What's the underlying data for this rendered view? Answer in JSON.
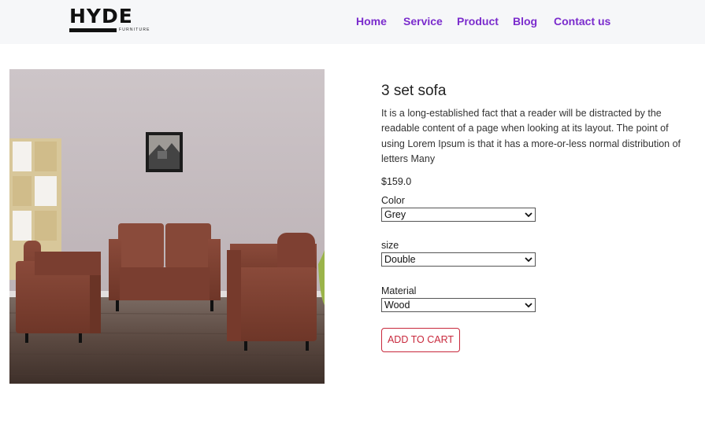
{
  "brand": {
    "name": "HYDE",
    "tagline": "FURNITURE"
  },
  "nav": {
    "items": [
      "Home",
      "Service",
      "Product",
      "Blog",
      "Contact us"
    ]
  },
  "product": {
    "title": "3 set sofa",
    "description": "It is a long-established fact that a reader will be distracted by the readable content of a page when looking at its layout. The point of using Lorem Ipsum is that it has a more-or-less normal distribution of letters Many",
    "price": "$159.0",
    "color": {
      "label": "Color",
      "value": "Grey"
    },
    "size": {
      "label": "size",
      "value": "Double"
    },
    "material": {
      "label": "Material",
      "value": "Wood"
    },
    "cart_button": "ADD TO CART"
  },
  "colors": {
    "nav_link": "#7b2ccd",
    "cart_accent": "#c8283c",
    "header_bg": "#f6f7f9"
  },
  "icons": {
    "select_arrow": "chevron-down-icon"
  }
}
